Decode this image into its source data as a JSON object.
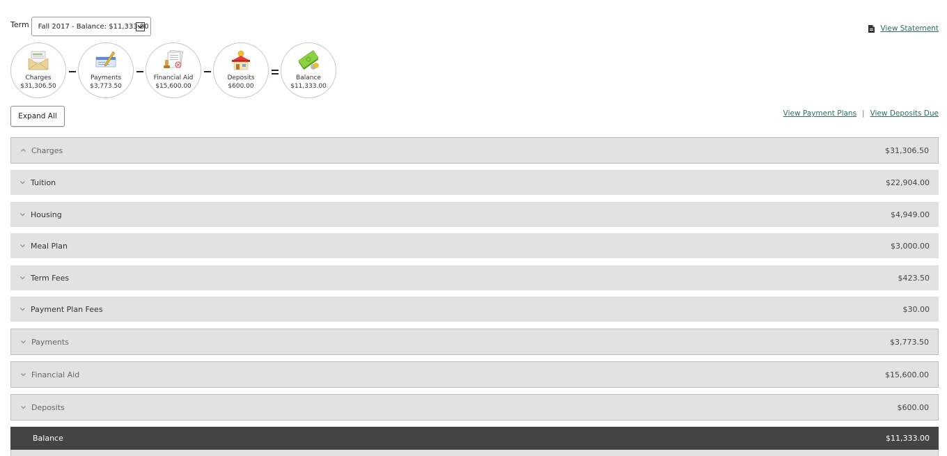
{
  "term": {
    "label": "Term",
    "selected": "Fall 2017 - Balance: $11,333.00"
  },
  "links": {
    "view_statement": "View Statement",
    "view_payment_plans": "View Payment Plans",
    "separator": "|",
    "view_deposits_due": "View Deposits Due"
  },
  "summary": {
    "items": [
      {
        "label": "Charges",
        "amount": "$31,306.50",
        "icon": "envelope-invoice-icon"
      },
      {
        "label": "Payments",
        "amount": "$3,773.50",
        "icon": "check-pen-icon"
      },
      {
        "label": "Financial Aid",
        "amount": "$15,600.00",
        "icon": "document-stamp-icon"
      },
      {
        "label": "Deposits",
        "amount": "$600.00",
        "icon": "piggy-house-icon"
      },
      {
        "label": "Balance",
        "amount": "$11,333.00",
        "icon": "money-stack-icon"
      }
    ],
    "operators": [
      "minus",
      "minus",
      "minus",
      "equals"
    ]
  },
  "buttons": {
    "expand_all": "Expand All"
  },
  "rows": [
    {
      "type": "section",
      "label": "Charges",
      "amount": "$31,306.50",
      "expanded": true
    },
    {
      "type": "sub",
      "label": "Tuition",
      "amount": "$22,904.00",
      "expanded": false
    },
    {
      "type": "sub",
      "label": "Housing",
      "amount": "$4,949.00",
      "expanded": false
    },
    {
      "type": "sub",
      "label": "Meal Plan",
      "amount": "$3,000.00",
      "expanded": false
    },
    {
      "type": "sub",
      "label": "Term Fees",
      "amount": "$423.50",
      "expanded": false
    },
    {
      "type": "sub",
      "label": "Payment Plan Fees",
      "amount": "$30.00",
      "expanded": false
    },
    {
      "type": "section",
      "label": "Payments",
      "amount": "$3,773.50",
      "expanded": false
    },
    {
      "type": "section",
      "label": "Financial Aid",
      "amount": "$15,600.00",
      "expanded": false
    },
    {
      "type": "section",
      "label": "Deposits",
      "amount": "$600.00",
      "expanded": false
    },
    {
      "type": "balance",
      "label": "Balance",
      "amount": "$11,333.00"
    }
  ],
  "colors": {
    "link": "#2f6c5d",
    "row_bg": "#e2e2e2",
    "balance_bg": "#444444"
  }
}
